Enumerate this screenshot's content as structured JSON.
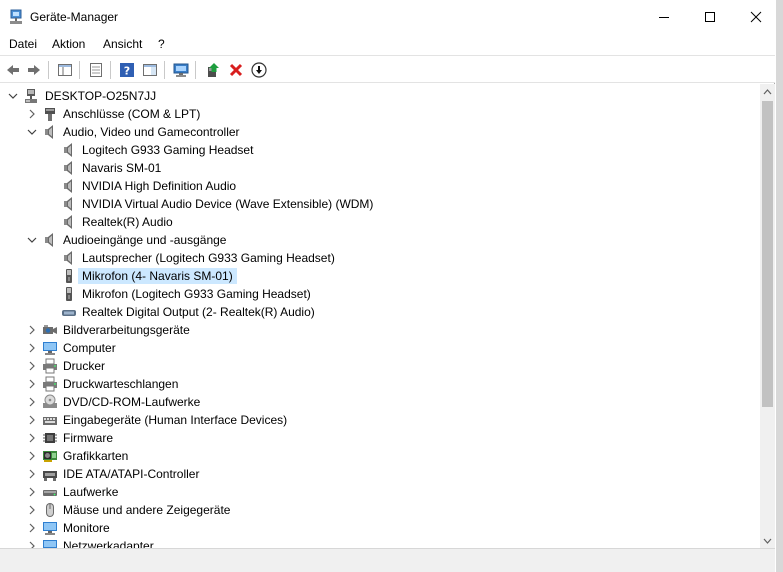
{
  "window": {
    "title": "Geräte-Manager"
  },
  "menu": {
    "items": [
      "Datei",
      "Aktion",
      "Ansicht",
      "?"
    ]
  },
  "toolbar": {
    "tools": [
      "back-arrow-icon",
      "forward-arrow-icon",
      "show-hide-console-tree-icon",
      "properties-icon",
      "help-icon",
      "action-pane-icon",
      "scan-hardware-icon",
      "update-driver-icon",
      "uninstall-device-icon",
      "disable-device-icon"
    ]
  },
  "tree": {
    "root": "DESKTOP-O25N7JJ",
    "rows": [
      {
        "label": "DESKTOP-O25N7JJ",
        "level": 0,
        "state": "expanded",
        "icon": "computer-root-icon"
      },
      {
        "label": "Anschlüsse (COM & LPT)",
        "level": 1,
        "state": "collapsed",
        "icon": "port-icon"
      },
      {
        "label": "Audio, Video und Gamecontroller",
        "level": 1,
        "state": "expanded",
        "icon": "speaker-icon"
      },
      {
        "label": "Logitech G933 Gaming Headset",
        "level": 2,
        "state": "leaf",
        "icon": "speaker-icon"
      },
      {
        "label": "Navaris SM-01",
        "level": 2,
        "state": "leaf",
        "icon": "speaker-icon"
      },
      {
        "label": "NVIDIA High Definition Audio",
        "level": 2,
        "state": "leaf",
        "icon": "speaker-icon"
      },
      {
        "label": "NVIDIA Virtual Audio Device (Wave Extensible) (WDM)",
        "level": 2,
        "state": "leaf",
        "icon": "speaker-icon"
      },
      {
        "label": "Realtek(R) Audio",
        "level": 2,
        "state": "leaf",
        "icon": "speaker-icon"
      },
      {
        "label": "Audioeingänge und -ausgänge",
        "level": 1,
        "state": "expanded",
        "icon": "speaker-icon"
      },
      {
        "label": "Lautsprecher (Logitech G933 Gaming Headset)",
        "level": 2,
        "state": "leaf",
        "icon": "speaker-icon"
      },
      {
        "label": "Mikrofon (4- Navaris SM-01)",
        "level": 2,
        "state": "leaf",
        "icon": "microphone-icon",
        "selected": true
      },
      {
        "label": "Mikrofon (Logitech G933 Gaming Headset)",
        "level": 2,
        "state": "leaf",
        "icon": "microphone-icon"
      },
      {
        "label": "Realtek Digital Output (2- Realtek(R) Audio)",
        "level": 2,
        "state": "leaf",
        "icon": "digital-output-icon"
      },
      {
        "label": "Bildverarbeitungsgeräte",
        "level": 1,
        "state": "collapsed",
        "icon": "camera-icon"
      },
      {
        "label": "Computer",
        "level": 1,
        "state": "collapsed",
        "icon": "monitor-icon"
      },
      {
        "label": "Drucker",
        "level": 1,
        "state": "collapsed",
        "icon": "printer-icon"
      },
      {
        "label": "Druckwarteschlangen",
        "level": 1,
        "state": "collapsed",
        "icon": "printer-icon"
      },
      {
        "label": "DVD/CD-ROM-Laufwerke",
        "level": 1,
        "state": "collapsed",
        "icon": "disc-icon"
      },
      {
        "label": "Eingabegeräte (Human Interface Devices)",
        "level": 1,
        "state": "collapsed",
        "icon": "hid-icon"
      },
      {
        "label": "Firmware",
        "level": 1,
        "state": "collapsed",
        "icon": "chip-icon"
      },
      {
        "label": "Grafikkarten",
        "level": 1,
        "state": "collapsed",
        "icon": "graphics-card-icon"
      },
      {
        "label": "IDE ATA/ATAPI-Controller",
        "level": 1,
        "state": "collapsed",
        "icon": "controller-icon"
      },
      {
        "label": "Laufwerke",
        "level": 1,
        "state": "collapsed",
        "icon": "drive-icon"
      },
      {
        "label": "Mäuse und andere Zeigegeräte",
        "level": 1,
        "state": "collapsed",
        "icon": "mouse-icon"
      },
      {
        "label": "Monitore",
        "level": 1,
        "state": "collapsed",
        "icon": "monitor-icon"
      },
      {
        "label": "Netzwerkadapter",
        "level": 1,
        "state": "collapsed",
        "icon": "network-icon"
      }
    ]
  },
  "colors": {
    "selection": "#cce8ff",
    "accent": "#0078d7"
  }
}
